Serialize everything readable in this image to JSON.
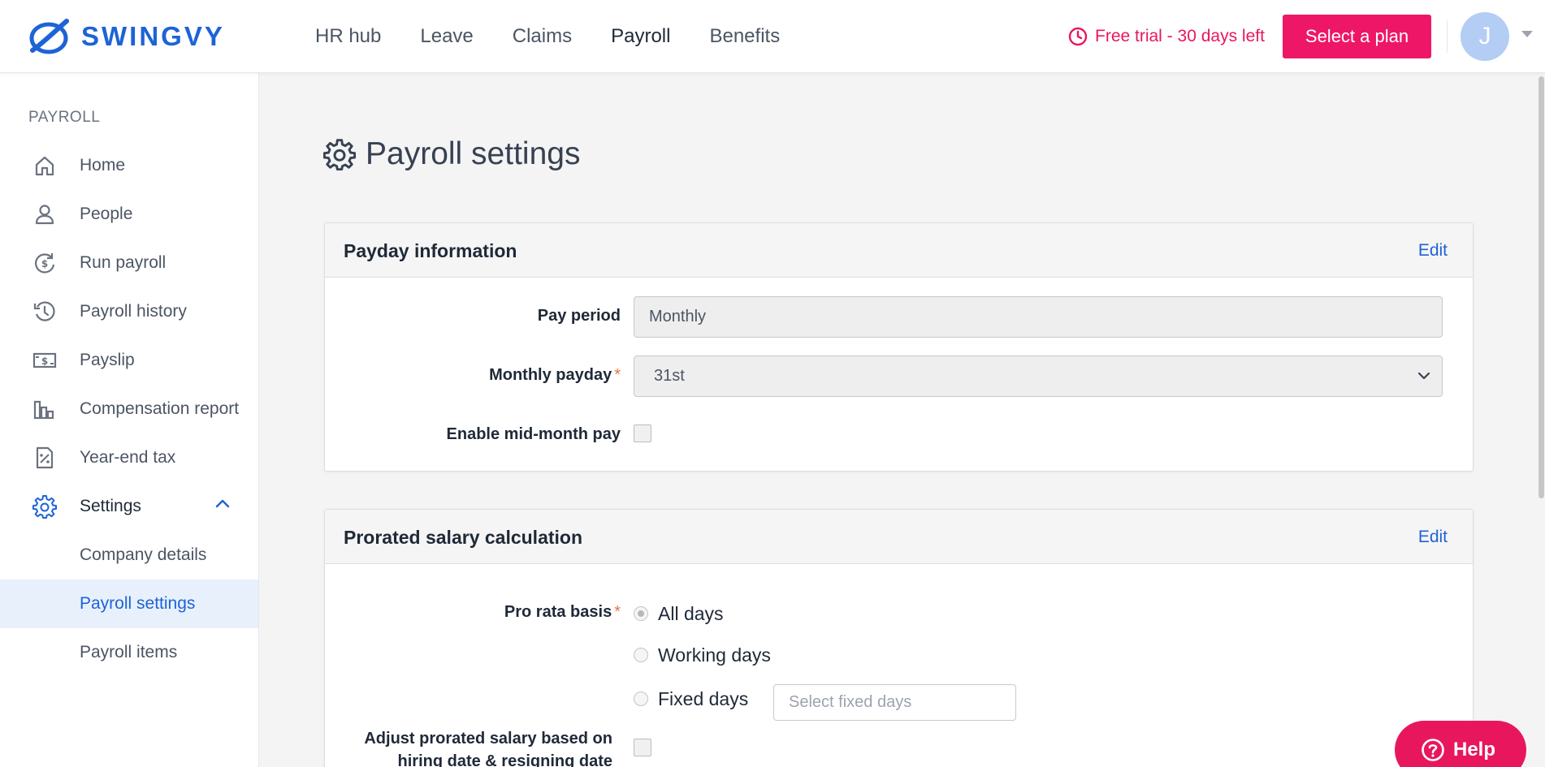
{
  "app": {
    "logo_text": "SWINGVY",
    "brand_color": "#1e63d6",
    "accent_color": "#ee1767"
  },
  "nav": {
    "items": [
      "HR hub",
      "Leave",
      "Claims",
      "Payroll",
      "Benefits"
    ],
    "active": "Payroll"
  },
  "trial": {
    "text": "Free trial - 30 days left",
    "icon": "clock-icon"
  },
  "plan_button": "Select a plan",
  "user": {
    "initial": "J"
  },
  "sidebar": {
    "section_title": "PAYROLL",
    "items": [
      {
        "label": "Home",
        "icon": "home-icon"
      },
      {
        "label": "People",
        "icon": "person-icon"
      },
      {
        "label": "Run payroll",
        "icon": "dollar-cycle-icon"
      },
      {
        "label": "Payroll history",
        "icon": "history-icon"
      },
      {
        "label": "Payslip",
        "icon": "banknote-icon"
      },
      {
        "label": "Compensation report",
        "icon": "bar-chart-icon"
      },
      {
        "label": "Year-end tax",
        "icon": "percent-document-icon"
      },
      {
        "label": "Settings",
        "icon": "gear-icon"
      }
    ],
    "sub_items": [
      "Company details",
      "Payroll settings",
      "Payroll items"
    ],
    "active_sub": "Payroll settings"
  },
  "page": {
    "title": "Payroll settings",
    "title_icon": "gear-icon"
  },
  "payday": {
    "title": "Payday information",
    "edit": "Edit",
    "pay_period_label": "Pay period",
    "pay_period_value": "Monthly",
    "monthly_payday_label": "Monthly payday",
    "monthly_payday_value": "31st",
    "required_mark": "*",
    "mid_month_label": "Enable mid-month pay",
    "mid_month_checked": false
  },
  "prorated": {
    "title": "Prorated salary calculation",
    "edit": "Edit",
    "basis_label": "Pro rata basis",
    "required_mark": "*",
    "options": [
      "All days",
      "Working days",
      "Fixed days"
    ],
    "selected": "All days",
    "fixed_days_placeholder": "Select fixed days",
    "adjust_label_line1": "Adjust prorated salary based on",
    "adjust_label_line2": "hiring date & resigning date",
    "adjust_checked": false
  },
  "help": {
    "label": "Help",
    "icon": "question-circle-icon"
  }
}
